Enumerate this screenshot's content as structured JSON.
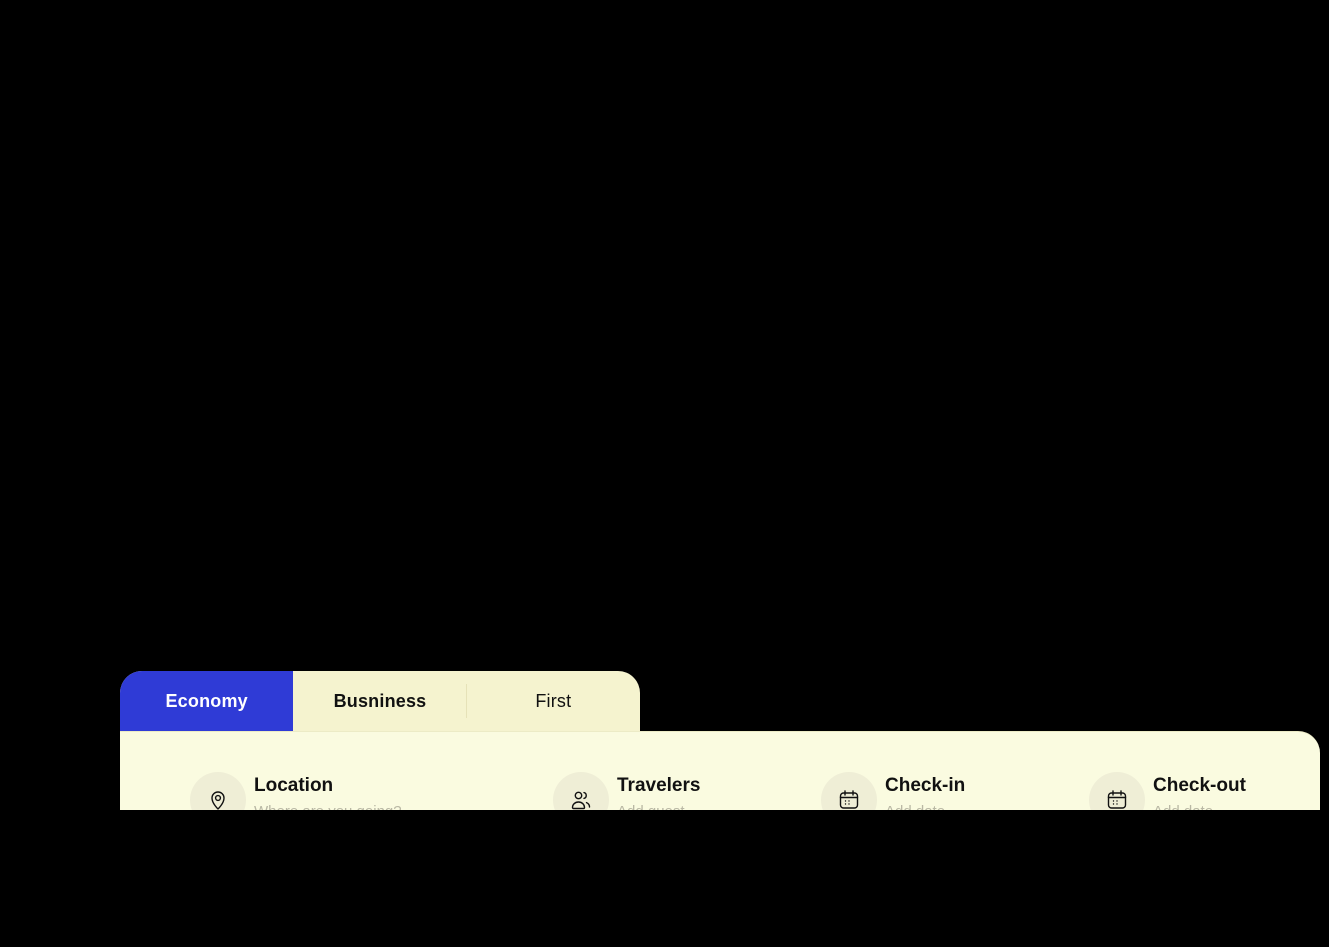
{
  "tabs": [
    {
      "label": "Economy",
      "active": true
    },
    {
      "label": "Busniness",
      "active": false
    },
    {
      "label": "First",
      "active": false
    }
  ],
  "fields": {
    "location": {
      "label": "Location",
      "placeholder": "Where are you going?",
      "icon": "map-pin-icon"
    },
    "travelers": {
      "label": "Travelers",
      "placeholder": "Add guest",
      "icon": "users-icon"
    },
    "checkin": {
      "label": "Check-in",
      "placeholder": "Add date",
      "icon": "calendar-icon"
    },
    "checkout": {
      "label": "Check-out",
      "placeholder": "Add date",
      "icon": "calendar-icon"
    }
  },
  "colors": {
    "accent": "#2f3bd6",
    "tab_bg": "#f5f3cf",
    "panel_bg": "#fafbe0",
    "page_bg": "#000000"
  }
}
